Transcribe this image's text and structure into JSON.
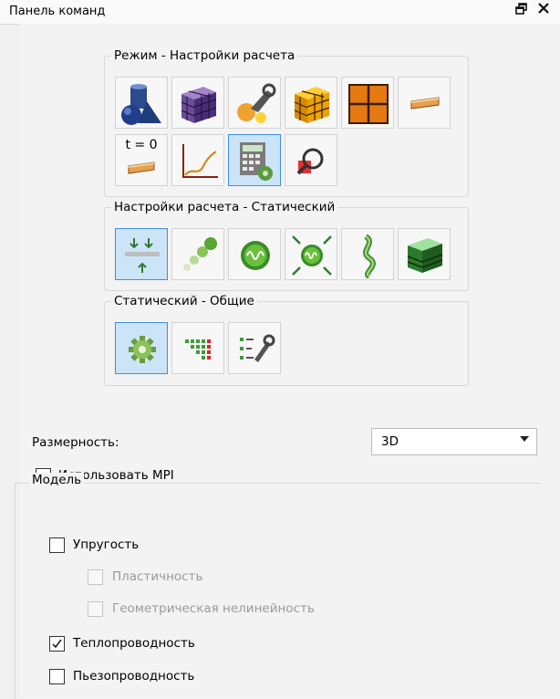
{
  "panel": {
    "title": "Панель команд",
    "float_icon": "restore-icon",
    "close_icon": "close-icon"
  },
  "groups": {
    "mode": {
      "label": "Режим - Настройки расчета",
      "buttons": [
        {
          "icon": "geometry-icon"
        },
        {
          "icon": "mesh-cube-icon"
        },
        {
          "icon": "properties-icon"
        },
        {
          "icon": "cube-grid-icon"
        },
        {
          "icon": "grid-plane-icon"
        },
        {
          "icon": "beam-icon"
        },
        {
          "icon": "initial-conditions-icon",
          "text": "t = 0"
        },
        {
          "icon": "graph-icon"
        },
        {
          "icon": "calculator-settings-icon",
          "active": true
        },
        {
          "icon": "zoom-result-icon"
        }
      ]
    },
    "calc": {
      "label": "Настройки расчета - Статический",
      "buttons": [
        {
          "icon": "static-icon",
          "active": true
        },
        {
          "icon": "dynamic-icon"
        },
        {
          "icon": "modal-icon"
        },
        {
          "icon": "buckling-icon"
        },
        {
          "icon": "harmonic-icon"
        },
        {
          "icon": "layered-cube-icon"
        }
      ]
    },
    "static": {
      "label": "Статический - Общие",
      "buttons": [
        {
          "icon": "settings-gear-icon",
          "active": true
        },
        {
          "icon": "matrix-icon"
        },
        {
          "icon": "list-settings-icon"
        }
      ]
    }
  },
  "dimension": {
    "label": "Размерность:",
    "value": "3D"
  },
  "mpi": {
    "label": "Использовать MPI",
    "checked": false
  },
  "model": {
    "legend": "Модель",
    "items": [
      {
        "label": "Упругость",
        "checked": false,
        "disabled": false,
        "indent": 0
      },
      {
        "label": "Пластичность",
        "checked": false,
        "disabled": true,
        "indent": 1
      },
      {
        "label": "Геометрическая нелинейность",
        "checked": false,
        "disabled": true,
        "indent": 1
      },
      {
        "label": "Теплопроводность",
        "checked": true,
        "disabled": false,
        "indent": 0
      },
      {
        "label": "Пьезопроводность",
        "checked": false,
        "disabled": false,
        "indent": 0
      }
    ]
  }
}
